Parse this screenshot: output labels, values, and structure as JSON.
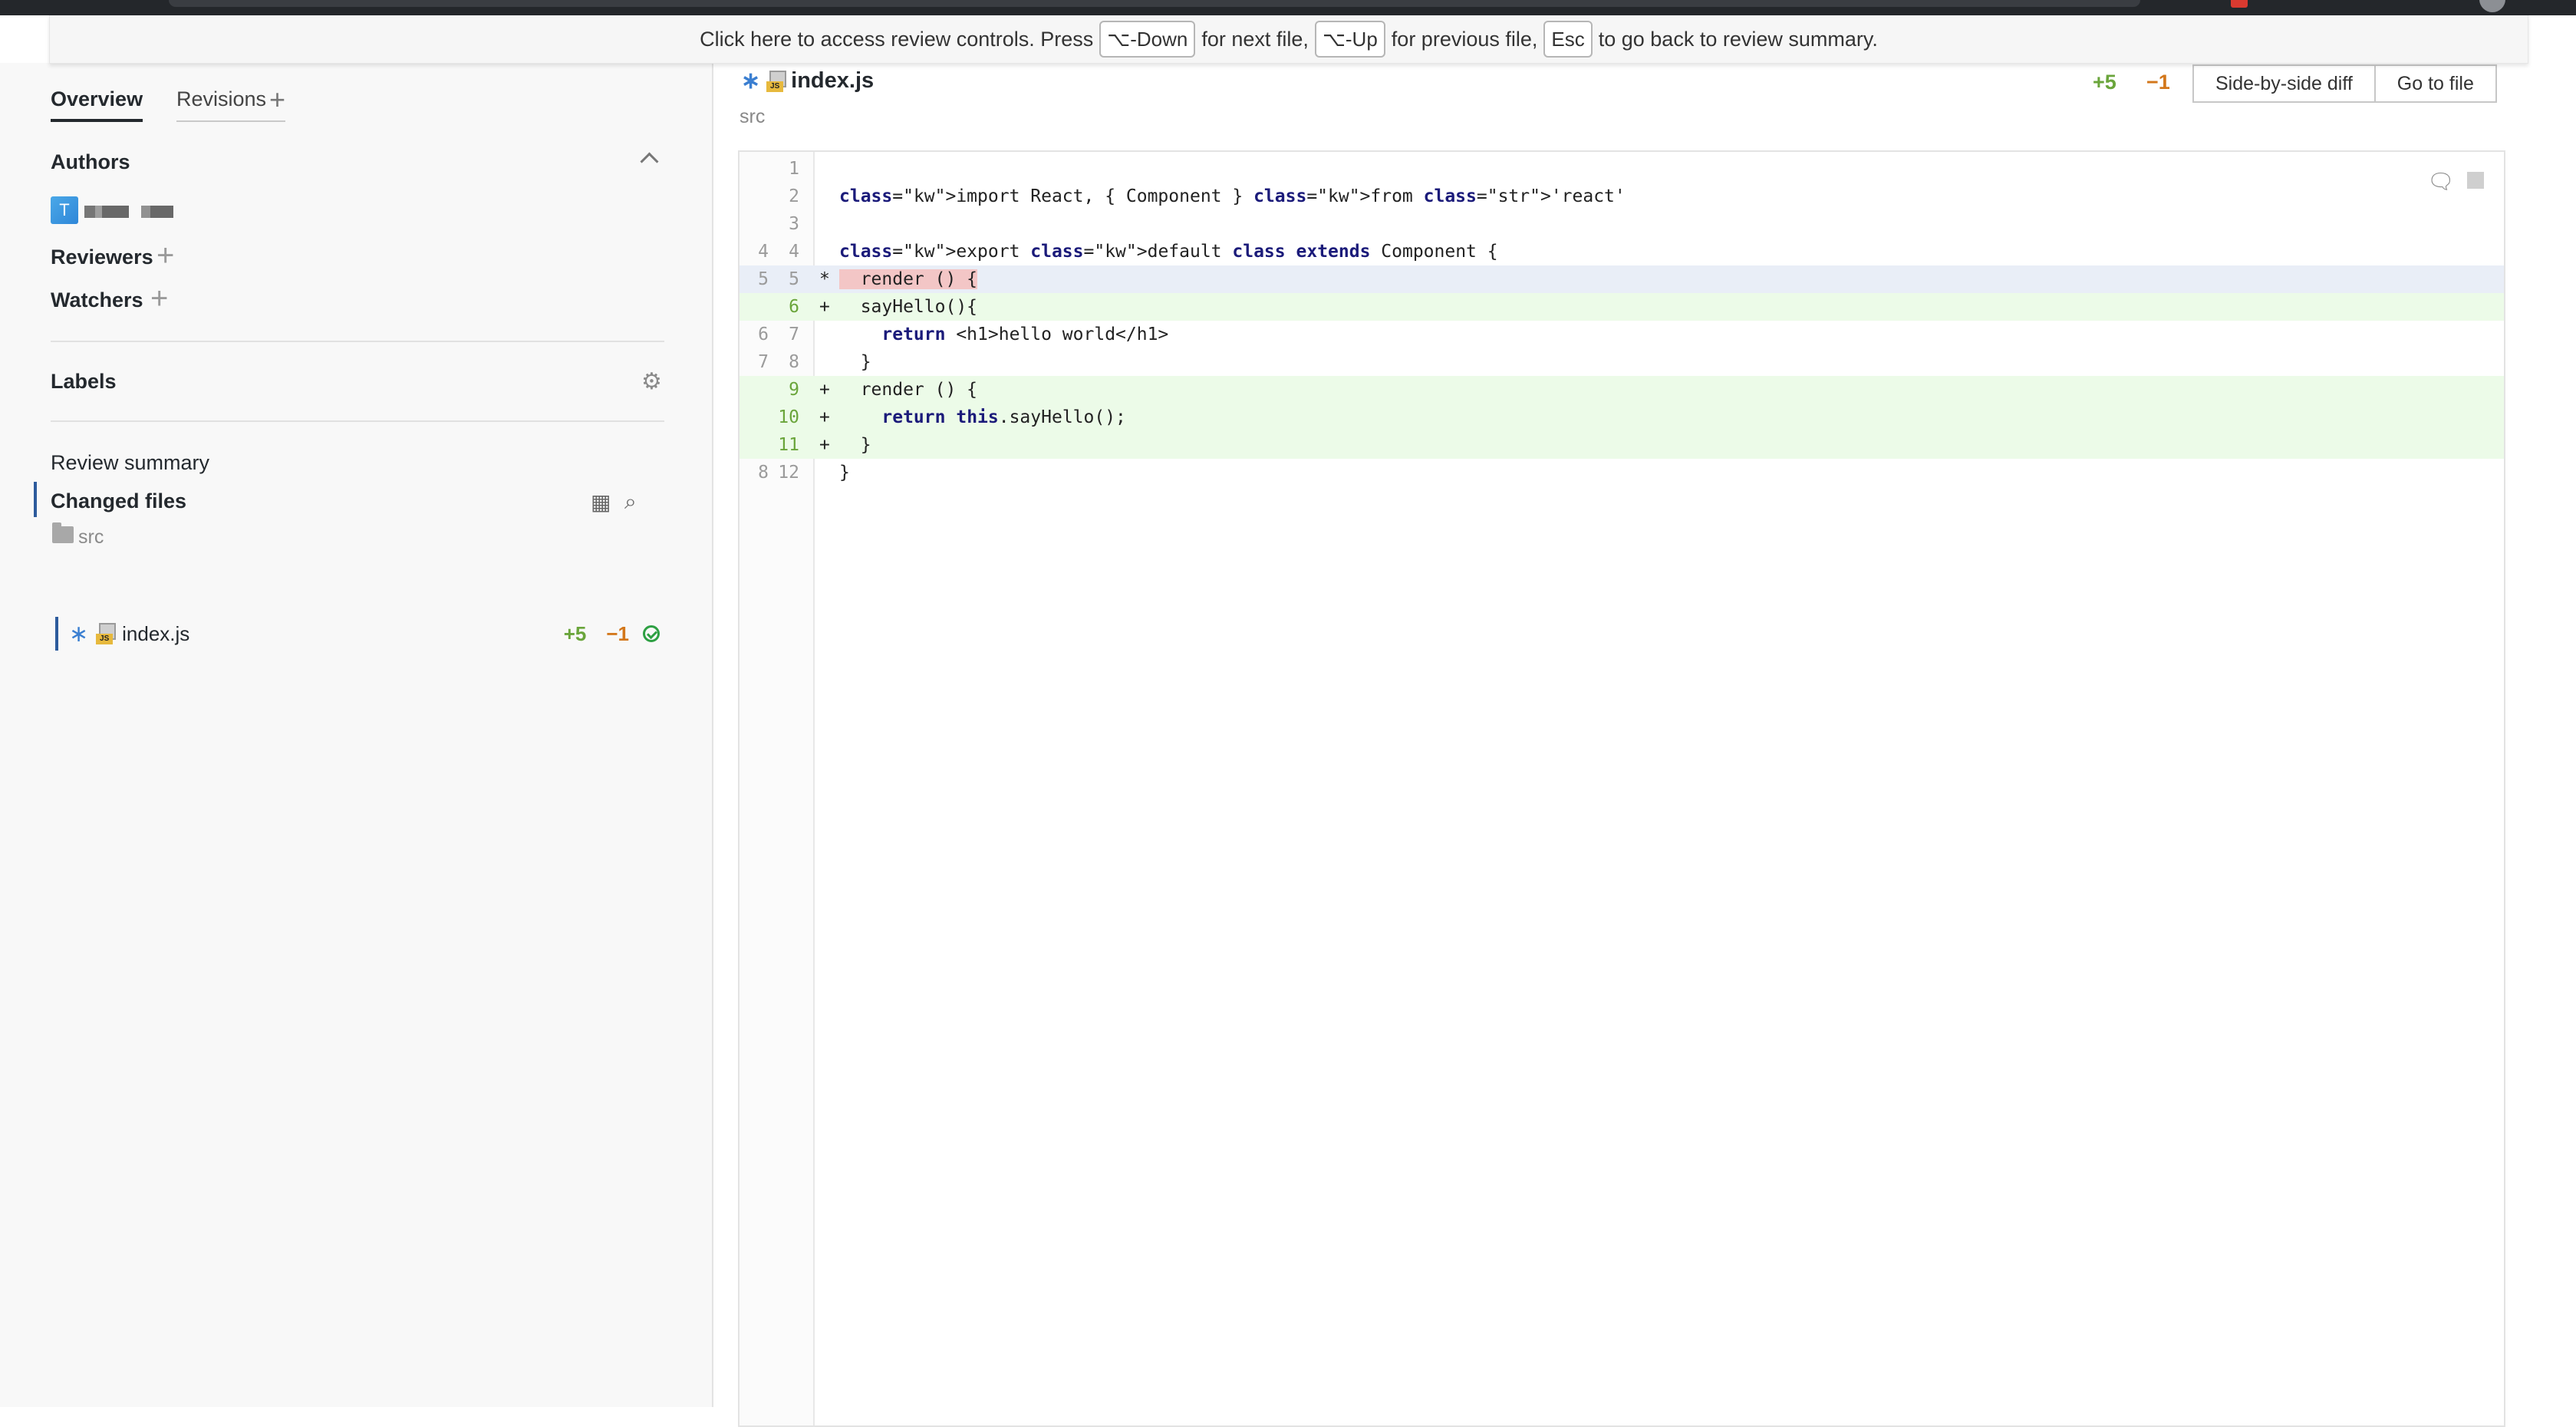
{
  "banner": {
    "t1": "Click here to access review controls. Press",
    "k1": "⌥-Down",
    "t2": "for next file,",
    "k2": "⌥-Up",
    "t3": "for previous file,",
    "k3": "Esc",
    "t4": "to go back to review summary."
  },
  "sidebar": {
    "tabs": {
      "overview": "Overview",
      "revisions": "Revisions",
      "revisions_plus": "+"
    },
    "authors_title": "Authors",
    "author_avatar_letter": "T",
    "reviewers_title": "Reviewers",
    "watchers_title": "Watchers",
    "labels_title": "Labels",
    "review_summary": "Review summary",
    "changed_files": "Changed files",
    "folder": "src",
    "file": {
      "name": "index.js",
      "added": "+5",
      "removed": "−1",
      "icon_label": "JS"
    }
  },
  "main": {
    "file_name": "index.js",
    "directory": "src",
    "added": "+5",
    "removed": "−1",
    "buttons": {
      "side_by_side": "Side-by-side diff",
      "go_to_file": "Go to file"
    },
    "code_lines": [
      {
        "old": "",
        "new": "1",
        "mark": "",
        "type": "ctx",
        "code": ""
      },
      {
        "old": "",
        "new": "2",
        "mark": "",
        "type": "ctx",
        "code": "import React, { Component } from 'react'"
      },
      {
        "old": "",
        "new": "3",
        "mark": "",
        "type": "ctx",
        "code": ""
      },
      {
        "old": "4",
        "new": "4",
        "mark": "",
        "type": "ctx",
        "code": "export default class extends Component {"
      },
      {
        "old": "5",
        "new": "5",
        "mark": "*",
        "type": "mod",
        "code": "  render () {"
      },
      {
        "old": "",
        "new": "6",
        "mark": "+",
        "type": "added",
        "code": "  sayHello(){"
      },
      {
        "old": "6",
        "new": "7",
        "mark": "",
        "type": "ctx",
        "code": "    return <h1>hello world</h1>"
      },
      {
        "old": "7",
        "new": "8",
        "mark": "",
        "type": "ctx",
        "code": "  }"
      },
      {
        "old": "",
        "new": "9",
        "mark": "+",
        "type": "added",
        "code": "  render () {"
      },
      {
        "old": "",
        "new": "10",
        "mark": "+",
        "type": "added",
        "code": "    return this.sayHello();"
      },
      {
        "old": "",
        "new": "11",
        "mark": "+",
        "type": "added",
        "code": "  }"
      },
      {
        "old": "8",
        "new": "12",
        "mark": "",
        "type": "ctx",
        "code": "}"
      }
    ]
  },
  "colors": {
    "added_bg": "#ecfbe8",
    "modified_bg": "#e9eef7",
    "added_text": "#6aa53b",
    "removed_text": "#d3771b",
    "accent_bar": "#2d5b9c"
  }
}
